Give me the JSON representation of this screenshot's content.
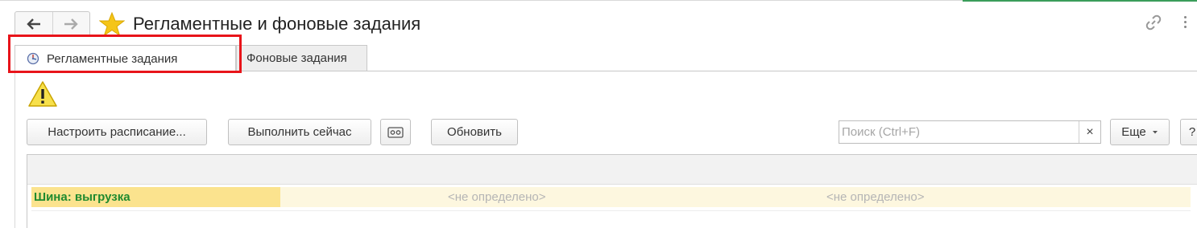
{
  "window": {
    "title": "Регламентные и фоновые задания"
  },
  "tabs": [
    {
      "label": "Регламентные задания",
      "active": true
    },
    {
      "label": "Фоновые задания",
      "active": false
    }
  ],
  "toolbar": {
    "schedule_label": "Настроить расписание...",
    "run_now_label": "Выполнить сейчас",
    "refresh_label": "Обновить",
    "more_label": "Еще",
    "help_label": "?",
    "clear_label": "×"
  },
  "search": {
    "placeholder": "Поиск (Ctrl+F)",
    "value": ""
  },
  "table": {
    "rows": [
      {
        "name": "Шина: выгрузка",
        "col2": "<не определено>",
        "col3": "<не определено>"
      }
    ]
  },
  "colors": {
    "highlight": "#e8141a",
    "selected_cell": "#fbe38e",
    "row_bg": "#fdf7df",
    "name_text": "#1f8a2f",
    "star": "#f5c518"
  },
  "icons": [
    "back-arrow-icon",
    "forward-arrow-icon",
    "favorite-star-icon",
    "link-icon",
    "more-vertical-icon",
    "scheduled-job-icon",
    "warning-icon",
    "cassette-icon",
    "dropdown-caret-icon"
  ]
}
